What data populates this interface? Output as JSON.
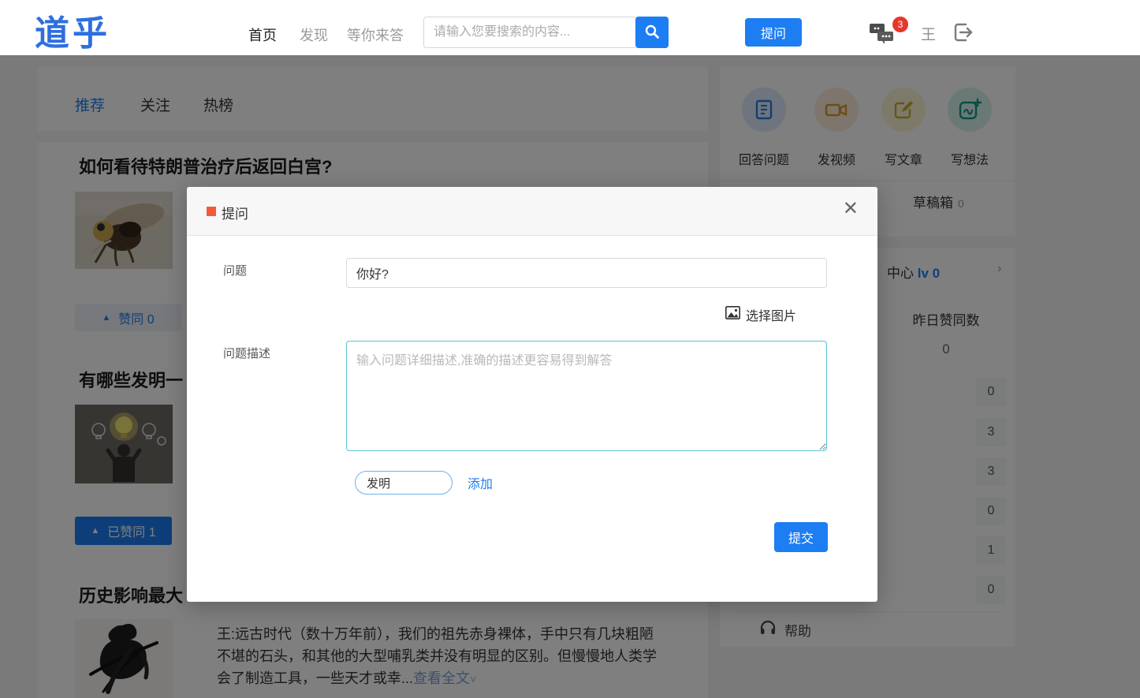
{
  "navbar": {
    "logo": "道乎",
    "items": [
      {
        "label": "首页"
      },
      {
        "label": "发现"
      },
      {
        "label": "等你来答"
      }
    ],
    "search_placeholder": "请输入您要搜索的内容...",
    "ask_button": "提问",
    "messages_badge": "3",
    "username": "王"
  },
  "feed": {
    "tabs": [
      {
        "label": "推荐"
      },
      {
        "label": "关注"
      },
      {
        "label": "热榜"
      }
    ],
    "questions": [
      {
        "title": "如何看待特朗普治疗后返回白宫?",
        "vote_label": "赞同 0",
        "vote_arrow": "▲"
      },
      {
        "title": "有哪些发明一",
        "vote_label": "已赞同 1",
        "vote_arrow": "▲"
      },
      {
        "title": "历史影响最大",
        "excerpt": "王:远古时代（数十万年前），我们的祖先赤身裸体，手中只有几块粗陋不堪的石头，和其他的大型哺乳类并没有明显的区别。但慢慢地人类学会了制造工具，一些天才或幸...",
        "read_more": "查看全文",
        "read_more_caret": "˅"
      }
    ]
  },
  "sidebar": {
    "shortcuts": [
      {
        "label": "回答问题",
        "icon": "answer-doc-icon",
        "color": "#2a7de0",
        "bg": "#dcebfc"
      },
      {
        "label": "发视频",
        "icon": "video-camera-icon",
        "color": "#d89a2e",
        "bg": "#fcecd9"
      },
      {
        "label": "写文章",
        "icon": "write-article-icon",
        "color": "#d3b93a",
        "bg": "#fbf4d5"
      },
      {
        "label": "写想法",
        "icon": "write-idea-icon",
        "color": "#12998a",
        "bg": "#d7f2ec"
      }
    ],
    "draft_label": "草稿箱",
    "draft_count": "0",
    "level_label": "中心",
    "level_value": "lv 0",
    "level_chevron": "›",
    "yesterday_label": "昨日赞同数",
    "yesterday_value": "0",
    "stats": [
      "0",
      "3",
      "3",
      "0",
      "1",
      "0"
    ],
    "help_label": "帮助"
  },
  "modal": {
    "title": "提问",
    "close": "✕",
    "question_label": "问题",
    "question_value": "你好?",
    "choose_image": "选择图片",
    "desc_label": "问题描述",
    "desc_placeholder": "输入问题详细描述,准确的描述更容易得到解答",
    "tag_value": "发明",
    "add_label": "添加",
    "submit": "提交"
  },
  "colors": {
    "primary": "#1d7df2",
    "badge_red": "#e5382c",
    "modal_mark_red": "#f4593f",
    "textarea_border": "#56c3d4",
    "logo_blue": "#2e6fe0"
  }
}
